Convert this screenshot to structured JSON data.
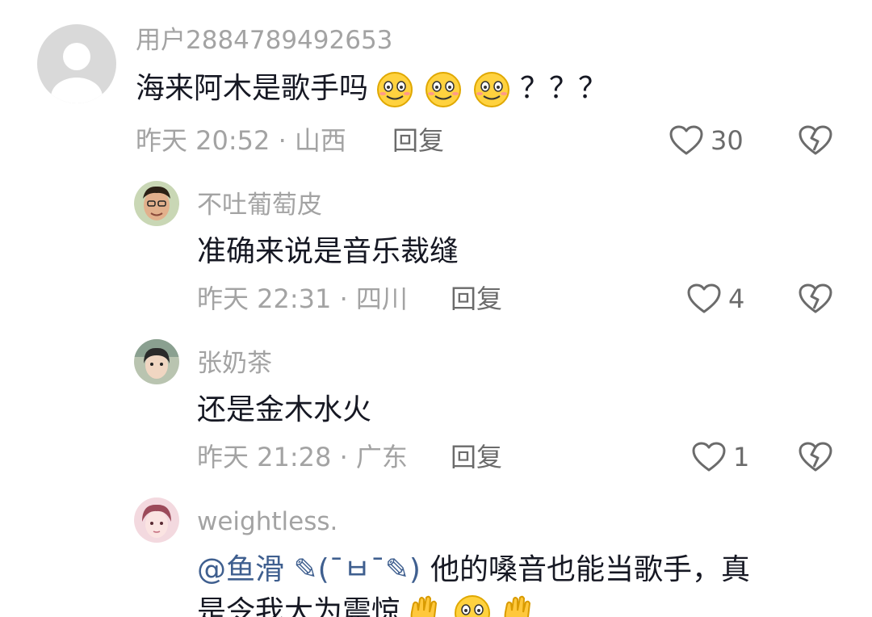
{
  "comments": [
    {
      "username": "用户2884789492653",
      "text": "海来阿木是歌手吗",
      "suffix": "？？？",
      "meta": "昨天 20:52 · 山西",
      "reply_label": "回复",
      "likes": "30",
      "emoji": "smile-emoji"
    },
    {
      "username": "不吐葡萄皮",
      "text": "准确来说是音乐裁缝",
      "meta": "昨天 22:31 · 四川",
      "reply_label": "回复",
      "likes": "4"
    },
    {
      "username": "张奶茶",
      "text": "还是金木水火",
      "meta": "昨天 21:28 · 广东",
      "reply_label": "回复",
      "likes": "1"
    },
    {
      "username": "weightless.",
      "mention": "@鱼滑 ✎(¯ㅂ¯✎)",
      "text": "他的嗓音也能当歌手，真",
      "text_line2": "是令我大为震惊"
    }
  ],
  "icons": {
    "like": "heart-outline-icon",
    "dislike": "broken-heart-icon",
    "emoji_smile": "smile-emoji",
    "emoji_ok": "ok-hand-emoji"
  },
  "colors": {
    "primary_text": "#161823",
    "secondary_text": "#a3a3a3",
    "action_text": "#6b6b6b",
    "mention": "#3f5f8f"
  }
}
